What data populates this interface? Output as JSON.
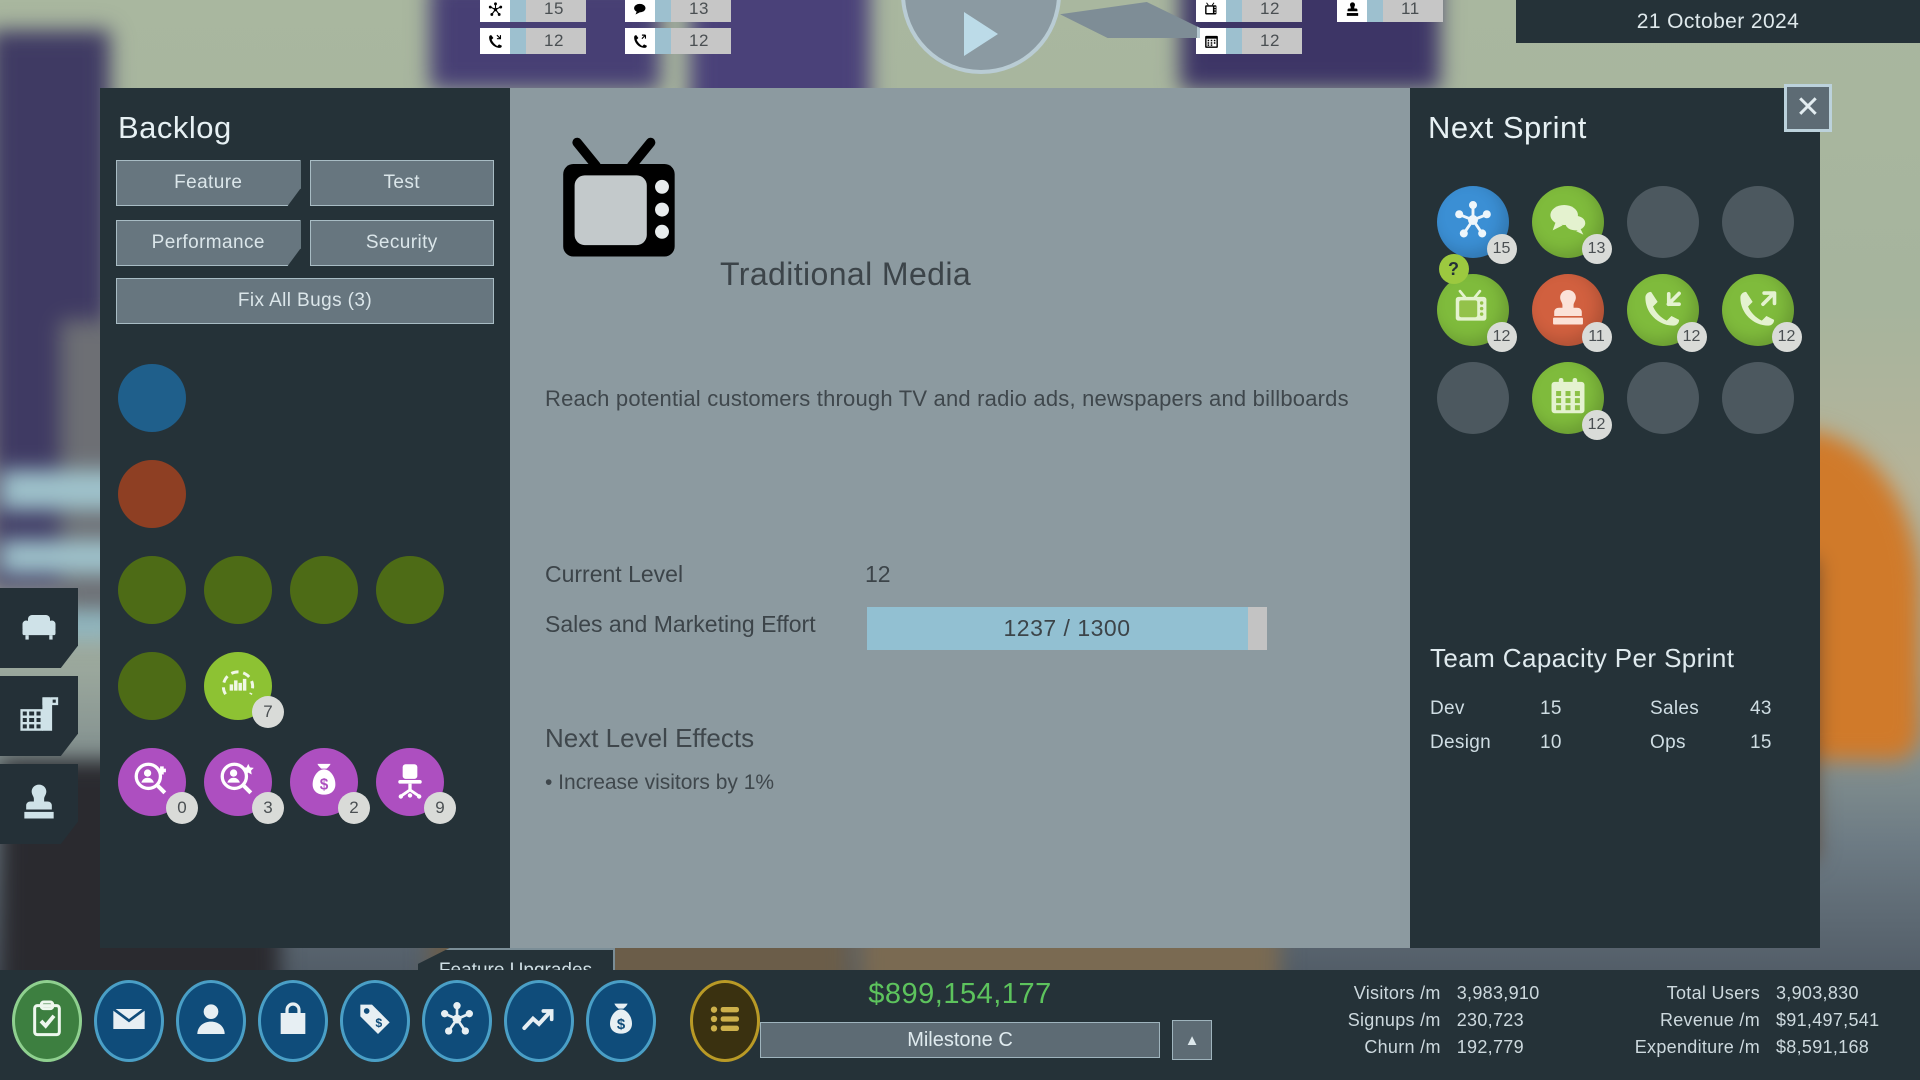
{
  "topbar": {
    "counters": [
      {
        "icon": "network-icon",
        "glyph": "✳",
        "value": "15"
      },
      {
        "icon": "chat-bubble-icon",
        "glyph": "💬",
        "value": "13"
      },
      {
        "icon": "phone-incoming-icon",
        "glyph": "📞",
        "value": "12"
      },
      {
        "icon": "phone-outgoing-icon",
        "glyph": "📞",
        "value": "12"
      },
      {
        "icon": "tv-icon",
        "glyph": "📺",
        "value": "12"
      },
      {
        "icon": "stamp-icon",
        "glyph": "♟",
        "value": "11"
      },
      {
        "icon": "calendar-icon",
        "glyph": "▦",
        "value": "12"
      }
    ],
    "date": "21 October 2024",
    "play_label": "play"
  },
  "sidetabs": [
    {
      "name": "lounge-tab",
      "icon": "couch-icon"
    },
    {
      "name": "office-tab",
      "icon": "office-building-icon"
    },
    {
      "name": "staff-tab",
      "icon": "person-stamp-icon"
    }
  ],
  "backlog": {
    "title": "Backlog",
    "buttons": [
      {
        "label": "Feature",
        "notch": true
      },
      {
        "label": "Test",
        "notch": false
      },
      {
        "label": "Performance",
        "notch": true
      },
      {
        "label": "Security",
        "notch": false
      }
    ],
    "fix_all_bugs": "Fix All Bugs (3)",
    "rows": [
      [
        {
          "color": "#1f5f8b",
          "icon": "",
          "badge": ""
        }
      ],
      [
        {
          "color": "#8e3f23",
          "icon": "",
          "badge": ""
        }
      ],
      [
        {
          "color": "#4d6b16",
          "icon": "",
          "badge": ""
        },
        {
          "color": "#4d6b16",
          "icon": "",
          "badge": ""
        },
        {
          "color": "#4d6b16",
          "icon": "",
          "badge": ""
        },
        {
          "color": "#4d6b16",
          "icon": "",
          "badge": ""
        }
      ],
      [
        {
          "color": "#4d6b16",
          "icon": "",
          "badge": ""
        },
        {
          "color": "#8dc233",
          "icon": "analytics-icon",
          "badge": "7"
        }
      ],
      [
        {
          "color": "#b martinez",
          "icon": "",
          "badge": ""
        }
      ]
    ],
    "purple_row": [
      {
        "color": "#ad4fc0",
        "icon": "user-search-plus-icon",
        "badge": "0"
      },
      {
        "color": "#ad4fc0",
        "icon": "user-search-star-icon",
        "badge": "3"
      },
      {
        "color": "#ad4fc0",
        "icon": "money-bag-icon",
        "badge": "2"
      },
      {
        "color": "#ad4fc0",
        "icon": "office-chair-icon",
        "badge": "9"
      }
    ],
    "feature_upgrades_tab": "Feature Upgrades"
  },
  "detail": {
    "icon": "tv-icon",
    "title": "Traditional Media",
    "description": "Reach potential customers through TV and radio ads, newspapers and billboards",
    "current_level_label": "Current Level",
    "current_level_value": "12",
    "effort_label": "Sales and Marketing Effort",
    "effort_current": 1237,
    "effort_max": 1300,
    "effort_text": "1237 / 1300",
    "next_level_title": "Next Level Effects",
    "next_level_effects": [
      "• Increase visitors by 1%"
    ]
  },
  "sprint": {
    "title": "Next Sprint",
    "close_label": "✕",
    "cells": [
      {
        "icon": "network-icon",
        "color": "#3b8fd4",
        "badge": "15",
        "filled": true,
        "qmark": false
      },
      {
        "icon": "chat-bubble-icon",
        "color": "#7fbb3c",
        "badge": "13",
        "filled": true,
        "qmark": false
      },
      {
        "icon": "",
        "color": "",
        "badge": "",
        "filled": false,
        "qmark": false
      },
      {
        "icon": "",
        "color": "",
        "badge": "",
        "filled": false,
        "qmark": false
      },
      {
        "icon": "tv-icon",
        "color": "#7fbb3c",
        "badge": "12",
        "filled": true,
        "qmark": true
      },
      {
        "icon": "stamp-icon",
        "color": "#d1603f",
        "badge": "11",
        "filled": true,
        "qmark": false
      },
      {
        "icon": "phone-incoming-icon",
        "color": "#7fbb3c",
        "badge": "12",
        "filled": true,
        "qmark": false
      },
      {
        "icon": "phone-outgoing-icon",
        "color": "#7fbb3c",
        "badge": "12",
        "filled": true,
        "qmark": false
      },
      {
        "icon": "",
        "color": "",
        "badge": "",
        "filled": false,
        "qmark": false
      },
      {
        "icon": "calendar-icon",
        "color": "#7fbb3c",
        "badge": "12",
        "filled": true,
        "qmark": false
      },
      {
        "icon": "",
        "color": "",
        "badge": "",
        "filled": false,
        "qmark": false
      },
      {
        "icon": "",
        "color": "",
        "badge": "",
        "filled": false,
        "qmark": false
      }
    ],
    "capacity_title": "Team Capacity Per Sprint",
    "capacity": [
      {
        "k1": "Dev",
        "v1": "15",
        "k2": "Sales",
        "v2": "43"
      },
      {
        "k1": "Design",
        "v1": "10",
        "k2": "Ops",
        "v2": "15"
      }
    ]
  },
  "bottom": {
    "nav": [
      {
        "name": "tasks-button",
        "icon": "clipboard-check-icon",
        "active": true,
        "gold": false
      },
      {
        "name": "mail-button",
        "icon": "envelope-icon",
        "active": false,
        "gold": false
      },
      {
        "name": "staff-button",
        "icon": "person-icon",
        "active": false,
        "gold": false
      },
      {
        "name": "products-button",
        "icon": "shopping-bag-icon",
        "active": false,
        "gold": false
      },
      {
        "name": "pricing-button",
        "icon": "price-tag-icon",
        "active": false,
        "gold": false
      },
      {
        "name": "marketing-button",
        "icon": "network-icon",
        "active": false,
        "gold": false
      },
      {
        "name": "stats-button",
        "icon": "trending-up-icon",
        "active": false,
        "gold": false
      },
      {
        "name": "finance-button",
        "icon": "money-bag-icon",
        "active": false,
        "gold": false
      },
      {
        "name": "menu-button",
        "icon": "list-menu-icon",
        "active": false,
        "gold": true
      }
    ],
    "money": "$899,154,177",
    "milestone": "Milestone C",
    "milestone_up": "▲",
    "metrics_left": [
      {
        "label": "Visitors /m",
        "value": "3,983,910"
      },
      {
        "label": "Signups /m",
        "value": "230,723"
      },
      {
        "label": "Churn /m",
        "value": "192,779"
      }
    ],
    "metrics_right": [
      {
        "label": "Total Users",
        "value": "3,903,830"
      },
      {
        "label": "Revenue /m",
        "value": "$91,497,541"
      },
      {
        "label": "Expenditure /m",
        "value": "$8,591,168"
      }
    ]
  }
}
